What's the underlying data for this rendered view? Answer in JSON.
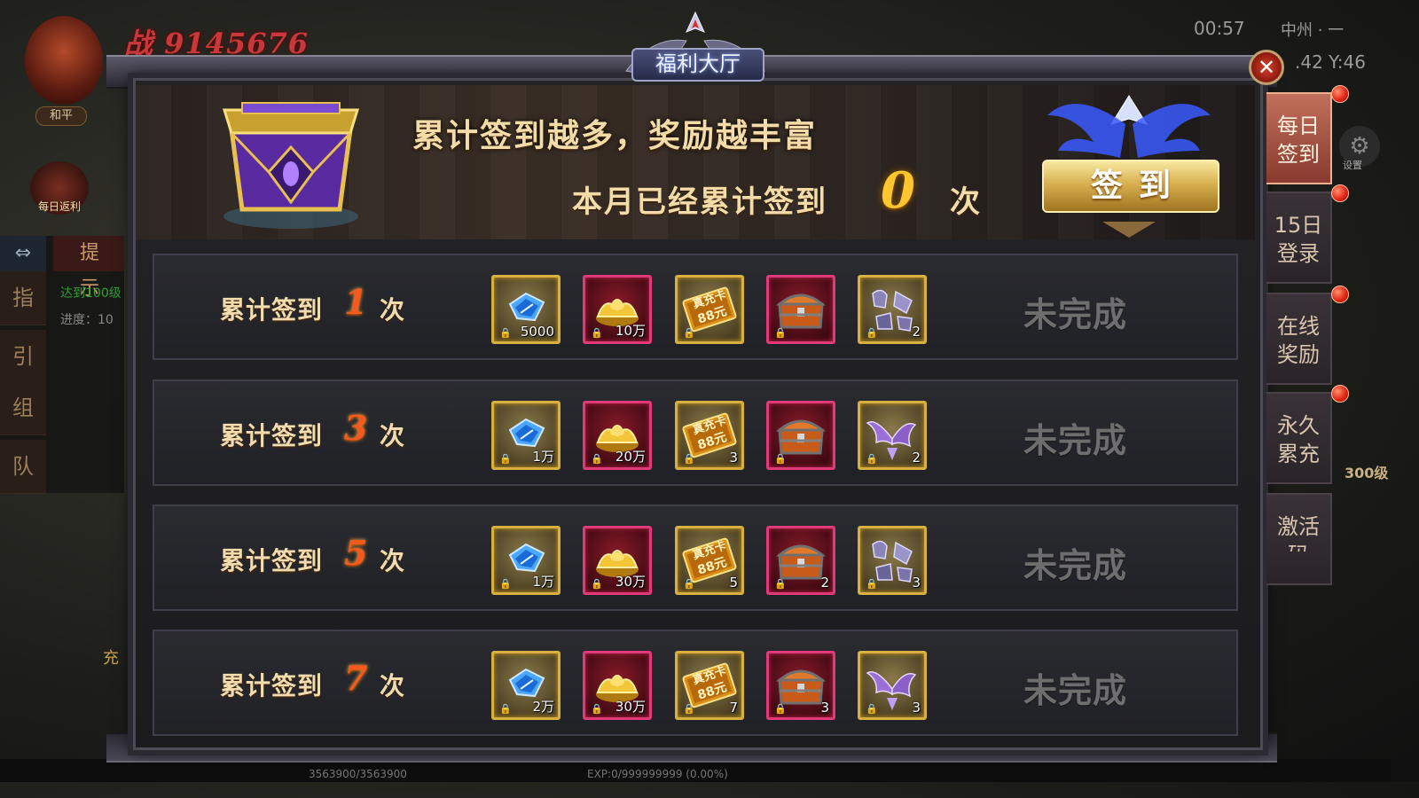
{
  "hud": {
    "power": "战 9145676",
    "peace_mode": "和平",
    "clock": "00:57",
    "map_name": "中州 · 一",
    "coord": ".42  Y:46",
    "daily_rebate": "每日返利",
    "settings": "设置",
    "left_tabs": [
      "指",
      "引",
      "组",
      "队"
    ],
    "tip_header": "提 示",
    "task_line1": "达到100级",
    "task_line2": "进度：10",
    "charge_label": "充",
    "level_badge": "300级",
    "hp_text": "3563900/3563900",
    "exp_text": "EXP:0/999999999 (0.00%)"
  },
  "dialog": {
    "title": "福利大厅",
    "close_label": "✕",
    "banner": {
      "slogan": "累计签到越多，奖励越丰富",
      "count_label": "本月已经累计签到",
      "count_value": "0",
      "count_unit": "次",
      "sign_button": "签到"
    },
    "row_label": "累计签到",
    "row_unit": "次",
    "rows": [
      {
        "times": "1",
        "status": "未完成",
        "items": [
          {
            "icon": "diamond-icon",
            "qty": "5000",
            "frame": "gold"
          },
          {
            "icon": "gold-ingot-icon",
            "qty": "10万",
            "frame": "red"
          },
          {
            "icon": "recharge-card-icon",
            "qty": "",
            "frame": "gold"
          },
          {
            "icon": "treasure-chest-icon",
            "qty": "",
            "frame": "red"
          },
          {
            "icon": "equipment-set-icon",
            "qty": "2",
            "frame": "gold"
          }
        ]
      },
      {
        "times": "3",
        "status": "未完成",
        "items": [
          {
            "icon": "diamond-icon",
            "qty": "1万",
            "frame": "gold"
          },
          {
            "icon": "gold-ingot-icon",
            "qty": "20万",
            "frame": "red"
          },
          {
            "icon": "recharge-card-icon",
            "qty": "3",
            "frame": "gold"
          },
          {
            "icon": "treasure-chest-icon",
            "qty": "",
            "frame": "red"
          },
          {
            "icon": "purple-wings-icon",
            "qty": "2",
            "frame": "gold"
          }
        ]
      },
      {
        "times": "5",
        "status": "未完成",
        "items": [
          {
            "icon": "diamond-icon",
            "qty": "1万",
            "frame": "gold"
          },
          {
            "icon": "gold-ingot-icon",
            "qty": "30万",
            "frame": "red"
          },
          {
            "icon": "recharge-card-icon",
            "qty": "5",
            "frame": "gold"
          },
          {
            "icon": "treasure-chest-icon",
            "qty": "2",
            "frame": "red"
          },
          {
            "icon": "equipment-set-icon",
            "qty": "3",
            "frame": "gold"
          }
        ]
      },
      {
        "times": "7",
        "status": "未完成",
        "items": [
          {
            "icon": "diamond-icon",
            "qty": "2万",
            "frame": "gold"
          },
          {
            "icon": "gold-ingot-icon",
            "qty": "30万",
            "frame": "red"
          },
          {
            "icon": "recharge-card-icon",
            "qty": "7",
            "frame": "gold"
          },
          {
            "icon": "treasure-chest-icon",
            "qty": "3",
            "frame": "red"
          },
          {
            "icon": "purple-wings-icon",
            "qty": "3",
            "frame": "gold"
          }
        ]
      }
    ],
    "card_text_top": "真充卡",
    "card_text_bottom": "88元"
  },
  "side_tabs": [
    {
      "label1": "每日",
      "label2": "签到",
      "active": true,
      "dot": true
    },
    {
      "label1": "15日",
      "label2": "登录",
      "active": false,
      "dot": true
    },
    {
      "label1": "在线",
      "label2": "奖励",
      "active": false,
      "dot": true
    },
    {
      "label1": "永久",
      "label2": "累充",
      "active": false,
      "dot": true
    },
    {
      "label1": "激活",
      "label2": "码",
      "active": false,
      "dot": false
    }
  ],
  "colors": {
    "accent_gold": "#f3dca8",
    "count_gold": "#ffc630",
    "row_number": "#f25a20",
    "status_grey": "#6e6e6e",
    "active_tab": "#c0705a"
  }
}
